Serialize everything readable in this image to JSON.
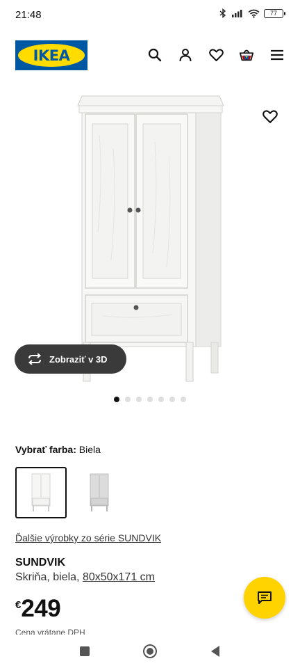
{
  "status": {
    "time": "21:48",
    "battery": "77"
  },
  "header": {
    "logo_text": "IKEA",
    "icons": [
      "search-icon",
      "user-icon",
      "heart-icon",
      "basket-icon",
      "menu-icon"
    ]
  },
  "gallery": {
    "view3d_label": "Zobraziť v 3D",
    "dots_total": 7,
    "active_dot": 0
  },
  "color": {
    "label": "Vybrať farba:",
    "value": "Biela",
    "swatches": [
      "Biela",
      "Sivá"
    ]
  },
  "product": {
    "series_link": "Ďalšie výrobky zo série SUNDVIK",
    "name": "SUNDVIK",
    "description": "Skriňa, biela, ",
    "dimensions": "80x50x171 cm",
    "currency": "€",
    "price": "249",
    "price_note": "Cena vrátane DPH"
  },
  "colors": {
    "ikea_blue": "#0058a3",
    "ikea_yellow": "#ffdb00",
    "chat_yellow": "#ffd300",
    "view3d_bg": "#3a3a3a"
  }
}
